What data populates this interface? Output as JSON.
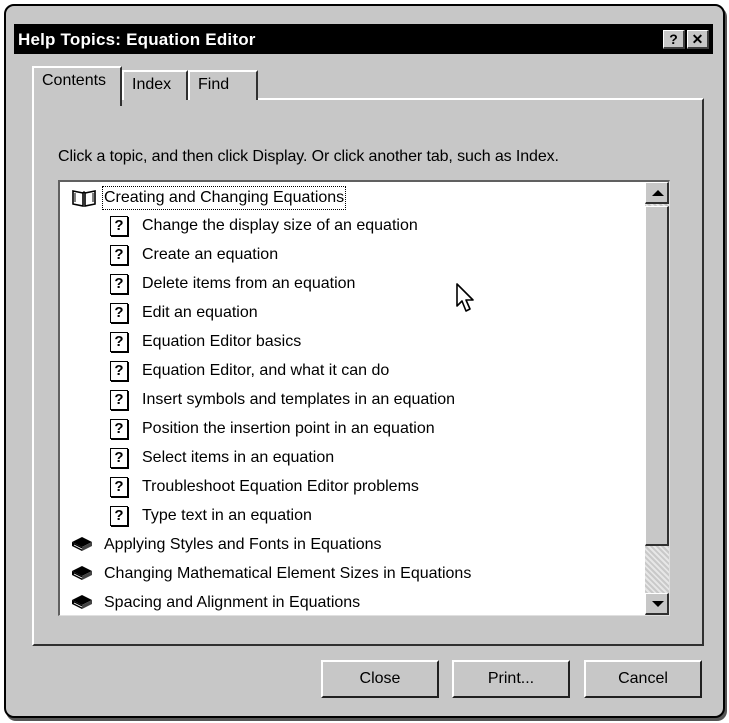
{
  "window": {
    "title": "Help Topics: Equation Editor",
    "help_button": "?",
    "close_button": "✕"
  },
  "tabs": [
    {
      "label": "Contents",
      "active": true
    },
    {
      "label": "Index",
      "active": false
    },
    {
      "label": "Find",
      "active": false
    }
  ],
  "instructions": "Click a topic, and then click Display. Or click another tab, such as Index.",
  "tree": {
    "open_book": "Creating and Changing Equations",
    "topics": [
      "Change the display size of an equation",
      "Create an equation",
      "Delete items from an equation",
      "Edit an equation",
      "Equation Editor basics",
      "Equation Editor, and what it can do",
      "Insert symbols and templates in an equation",
      "Position the insertion point in an equation",
      "Select items in an equation",
      "Troubleshoot Equation Editor problems",
      "Type text in an equation"
    ],
    "closed_books": [
      "Applying Styles and Fonts in Equations",
      "Changing Mathematical Element Sizes in Equations",
      "Spacing and Alignment in Equations"
    ],
    "topic_icon": "?"
  },
  "buttons": {
    "close": "Close",
    "print": "Print...",
    "cancel": "Cancel"
  }
}
